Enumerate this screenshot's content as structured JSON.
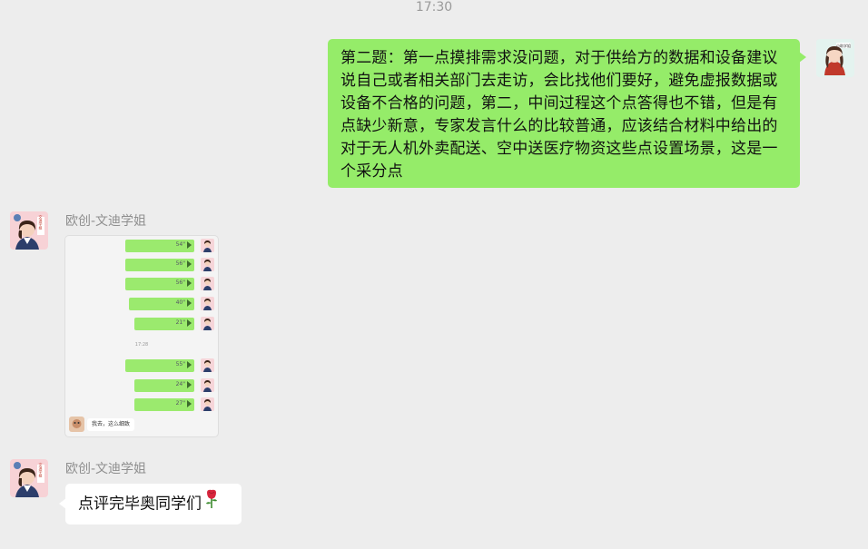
{
  "timestamp": "17:30",
  "messages": {
    "outgoing": {
      "text": "第二题：第一点摸排需求没问题，对于供给方的数据和设备建议说自己或者相关部门去走访，会比找他们要好，避免虚报数据或设备不合格的问题，第二，中间过程这个点答得也不错，但是有点缺少新意，专家发言什么的比较普通，应该结合材料中给出的对于无人机外卖配送、空中送医疗物资这些点设置场景，这是一个采分点",
      "avatar_label": "小助学姐"
    },
    "incoming_image": {
      "sender": "欧创-文迪学姐",
      "avatar_label": "文迪学姐",
      "voice_durations": [
        "54\"",
        "56\"",
        "56\"",
        "40\"",
        "21\"",
        "55\"",
        "24\"",
        "27\""
      ],
      "inner_time": "17:28",
      "inner_caption": "我去，这么细致"
    },
    "incoming_text": {
      "sender": "欧创-文迪学姐",
      "avatar_label": "文迪学姐",
      "text": "点评完毕奥同学们",
      "emoji": "rose-emoji"
    }
  },
  "colors": {
    "background": "#ededed",
    "outgoing_bubble": "#95ec69",
    "incoming_bubble": "#ffffff"
  }
}
